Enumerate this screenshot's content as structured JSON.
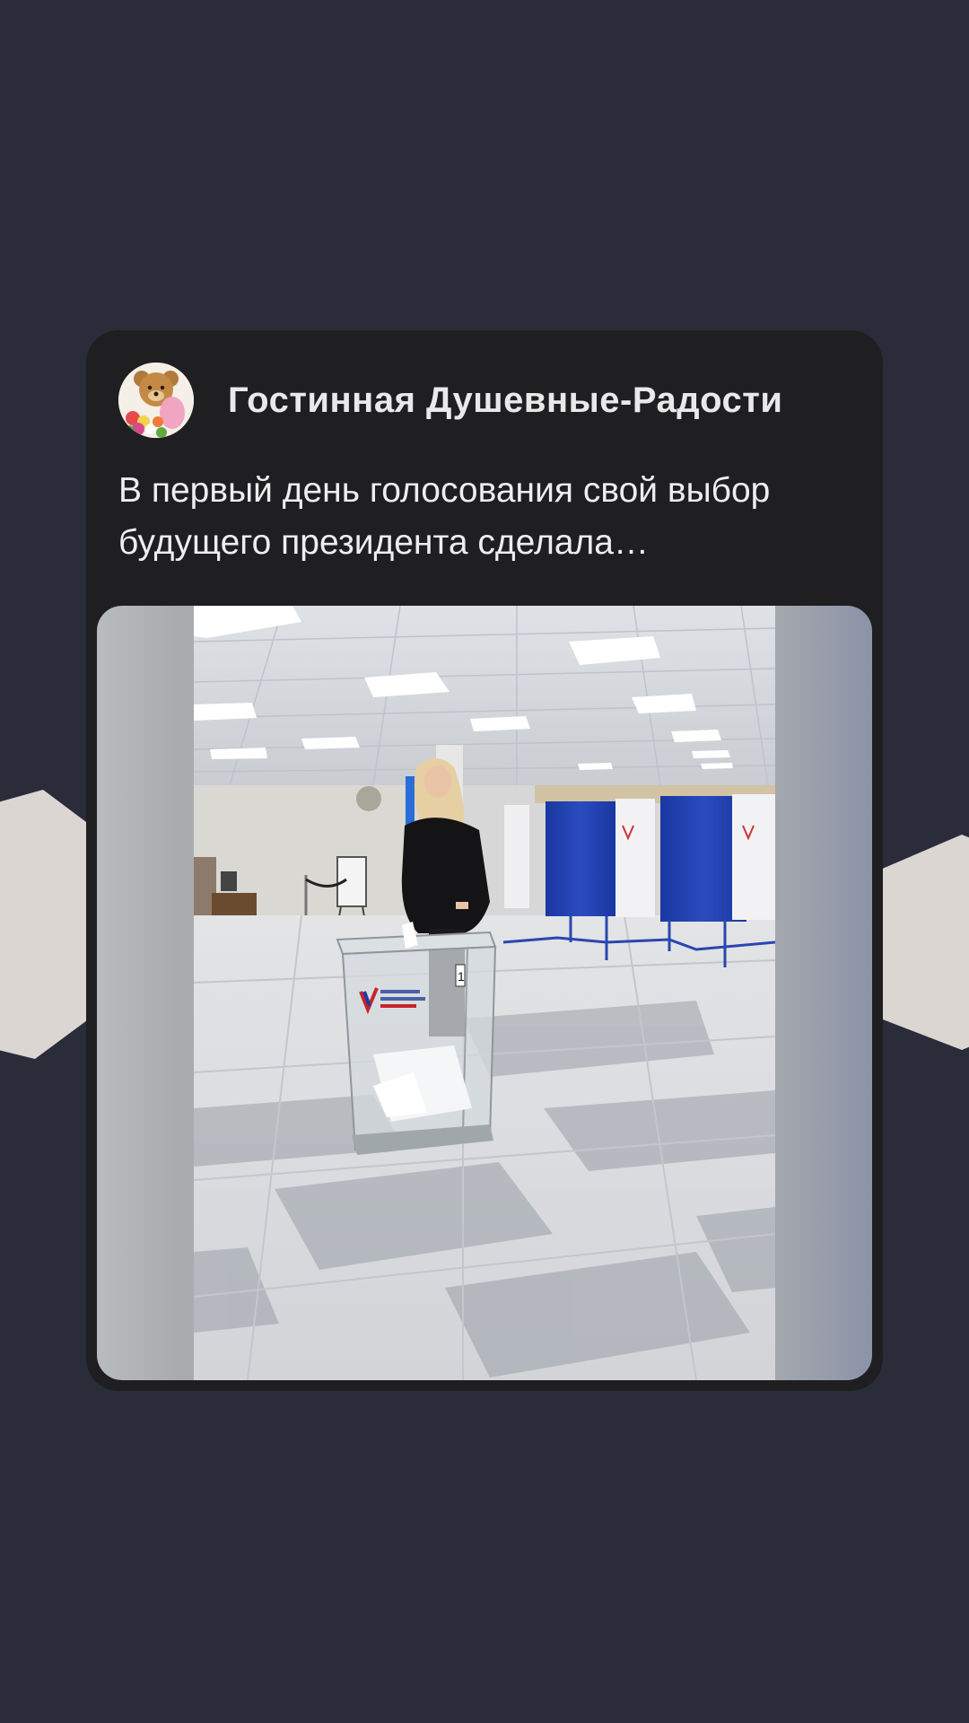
{
  "post": {
    "author": "Гостинная Душевные-Радости",
    "text": "В первый день голосования свой выбор будущего президента сделала…"
  },
  "icons": {
    "avatar": "teddy-bear-with-flowers-avatar"
  },
  "colors": {
    "background": "#2b2c3a",
    "card": "#1f1f21",
    "text": "#eeeeef",
    "booth_curtain": "#1f3fa8"
  }
}
